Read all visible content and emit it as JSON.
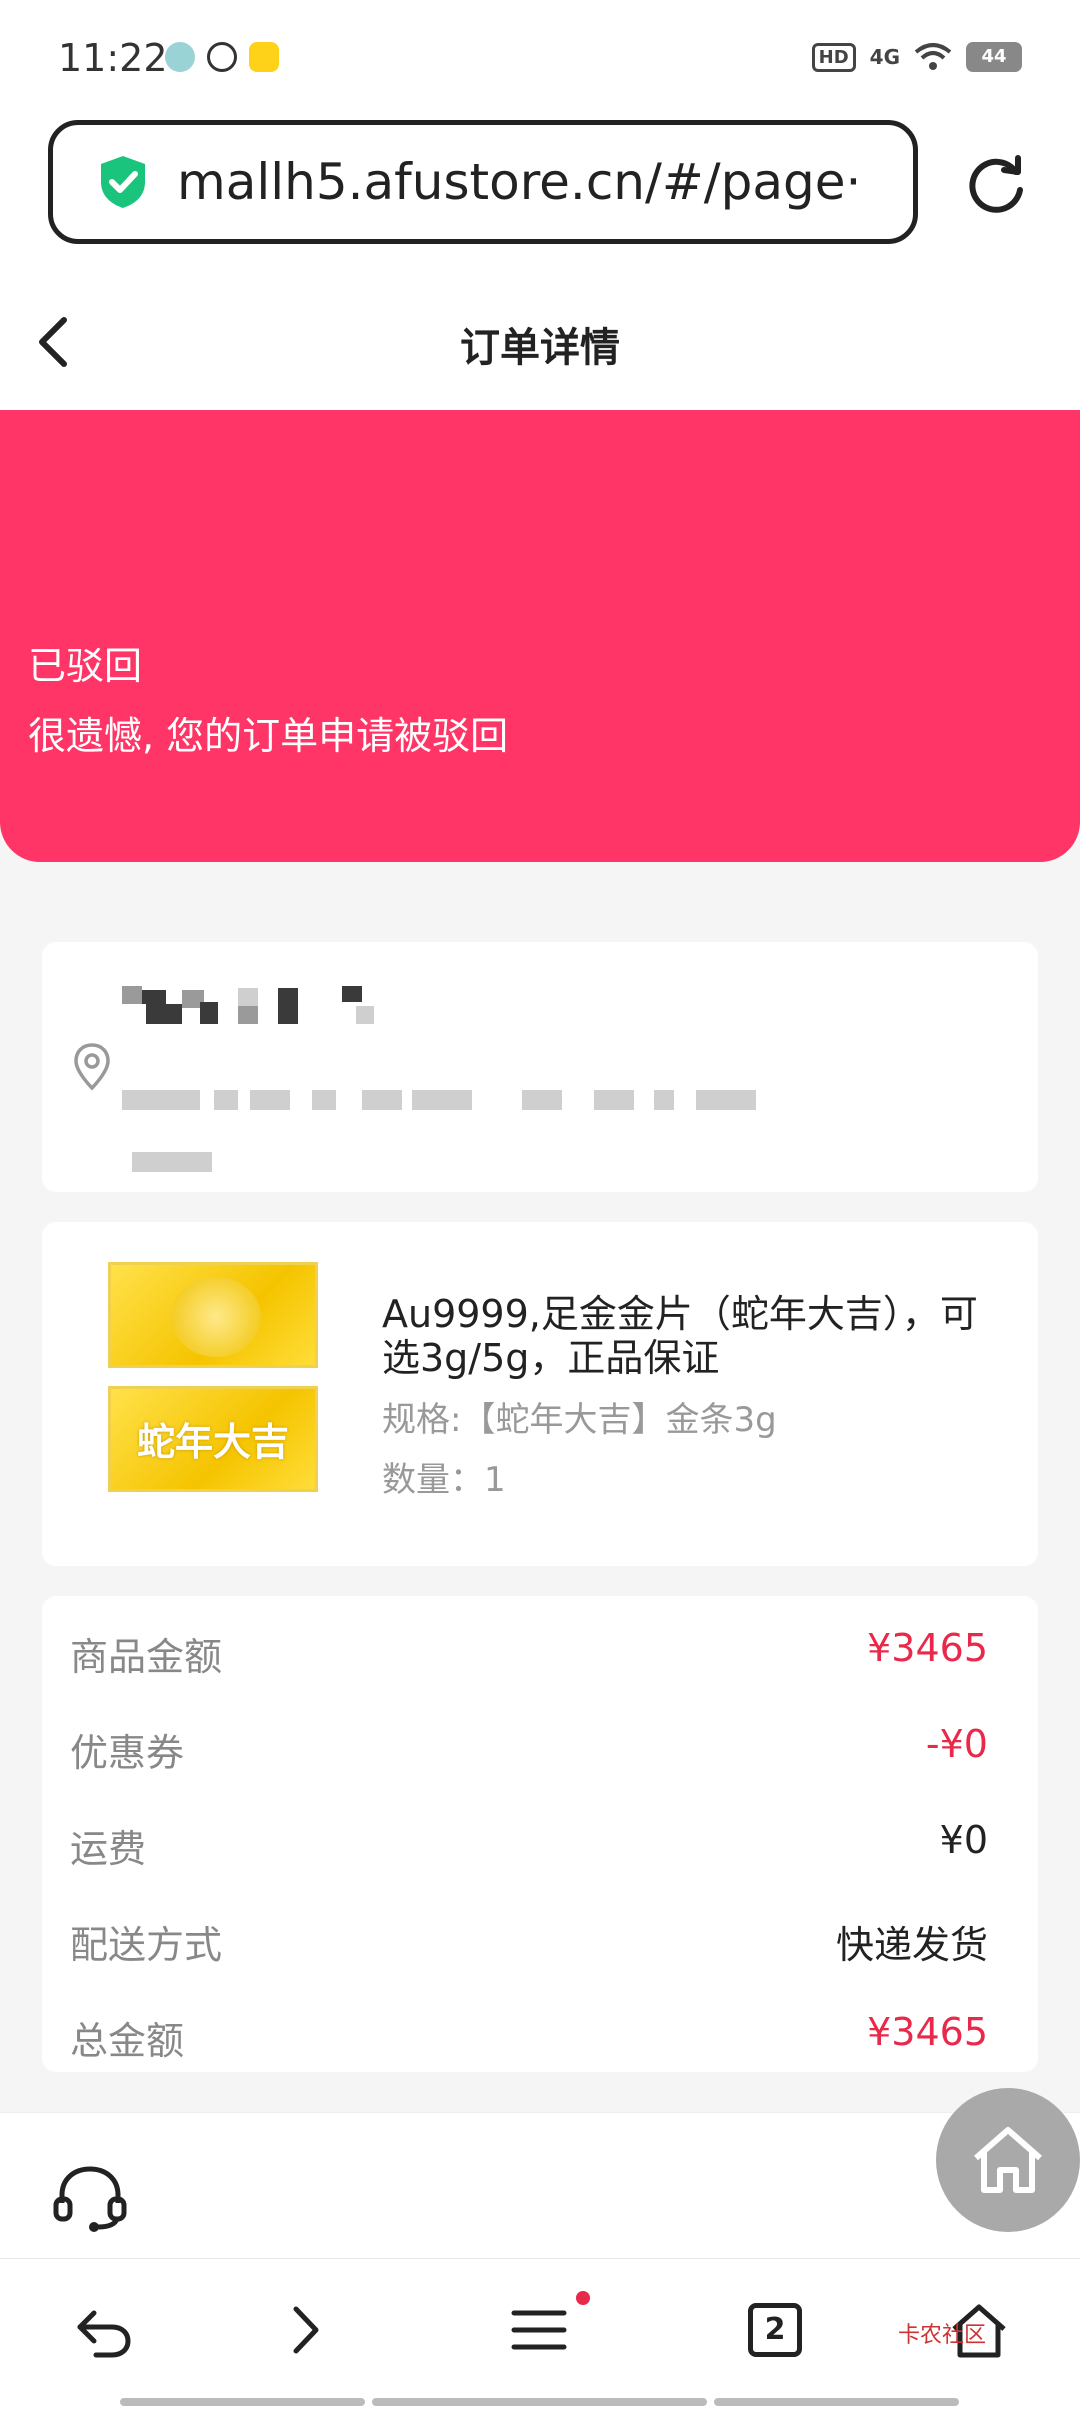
{
  "status_bar": {
    "time": "11:22",
    "hd": "HD",
    "network": "4G",
    "battery": "44"
  },
  "browser": {
    "url": "mallh5.afustore.cn/#/page···"
  },
  "header": {
    "title": "订单详情"
  },
  "banner": {
    "status": "已驳回",
    "message": "很遗憾, 您的订单申请被驳回"
  },
  "product": {
    "image_text": "蛇年大吉",
    "name": "Au9999,足金金片（蛇年大吉），可选3g/5g，正品保证",
    "spec": "规格:【蛇年大吉】金条3g",
    "qty": "数量：1"
  },
  "summary": [
    {
      "label": "商品金额",
      "value": "¥3465"
    },
    {
      "label": "优惠券",
      "value": "-¥0"
    },
    {
      "label": "运费",
      "value": "¥0"
    },
    {
      "label": "配送方式",
      "value": "快递发货"
    },
    {
      "label": "总金额",
      "value": "¥3465"
    }
  ],
  "bottom_bar": {
    "tab_count": "2",
    "watermark": "卡农社区"
  },
  "colors": {
    "banner": "#fe3566",
    "price_red": "#e8294a",
    "secure_green": "#1bc47d"
  }
}
